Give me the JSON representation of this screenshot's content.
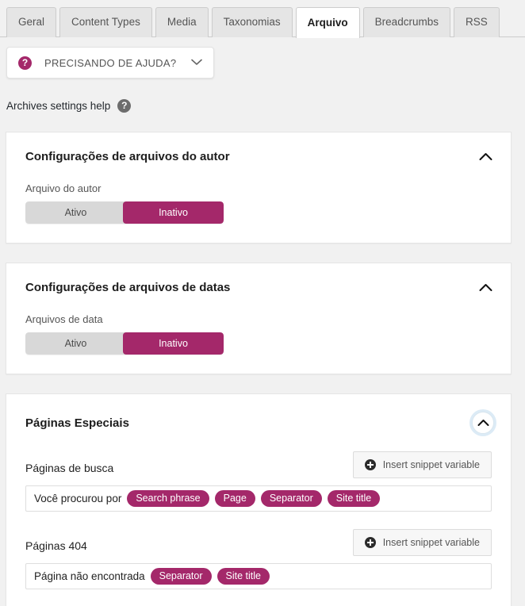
{
  "tabs": [
    {
      "label": "Geral",
      "active": false
    },
    {
      "label": "Content Types",
      "active": false
    },
    {
      "label": "Media",
      "active": false
    },
    {
      "label": "Taxonomias",
      "active": false
    },
    {
      "label": "Arquivo",
      "active": true
    },
    {
      "label": "Breadcrumbs",
      "active": false
    },
    {
      "label": "RSS",
      "active": false
    }
  ],
  "help_button": {
    "label": "PRECISANDO DE AJUDA?",
    "icon": "question-mark-circle-icon",
    "chevron": "chevron-down-icon"
  },
  "archives_help": {
    "label": "Archives settings help",
    "icon": "question-mark-circle-icon"
  },
  "toggle_options": {
    "on": "Ativo",
    "off": "Inativo"
  },
  "cards": {
    "author_archives": {
      "title": "Configurações de arquivos do autor",
      "collapse_icon": "chevron-up-icon",
      "field_label": "Arquivo do autor",
      "toggle_active": "Inativo"
    },
    "date_archives": {
      "title": "Configurações de arquivos de datas",
      "collapse_icon": "chevron-up-icon",
      "field_label": "Arquivos de data",
      "toggle_active": "Inativo"
    },
    "special_pages": {
      "title": "Páginas Especiais",
      "collapse_icon": "chevron-up-icon",
      "snippet_button_label": "Insert snippet variable",
      "rows": [
        {
          "label": "Páginas de busca",
          "prefix_text": "Você procurou por",
          "pills": [
            "Search phrase",
            "Page",
            "Separator",
            "Site title"
          ]
        },
        {
          "label": "Páginas 404",
          "prefix_text": "Página não encontrada",
          "pills": [
            "Separator",
            "Site title"
          ]
        }
      ]
    }
  },
  "colors": {
    "accent": "#a4286a",
    "page_background": "#f1f1f1",
    "card_background": "#ffffff",
    "focus_ring": "#8cbee1"
  }
}
